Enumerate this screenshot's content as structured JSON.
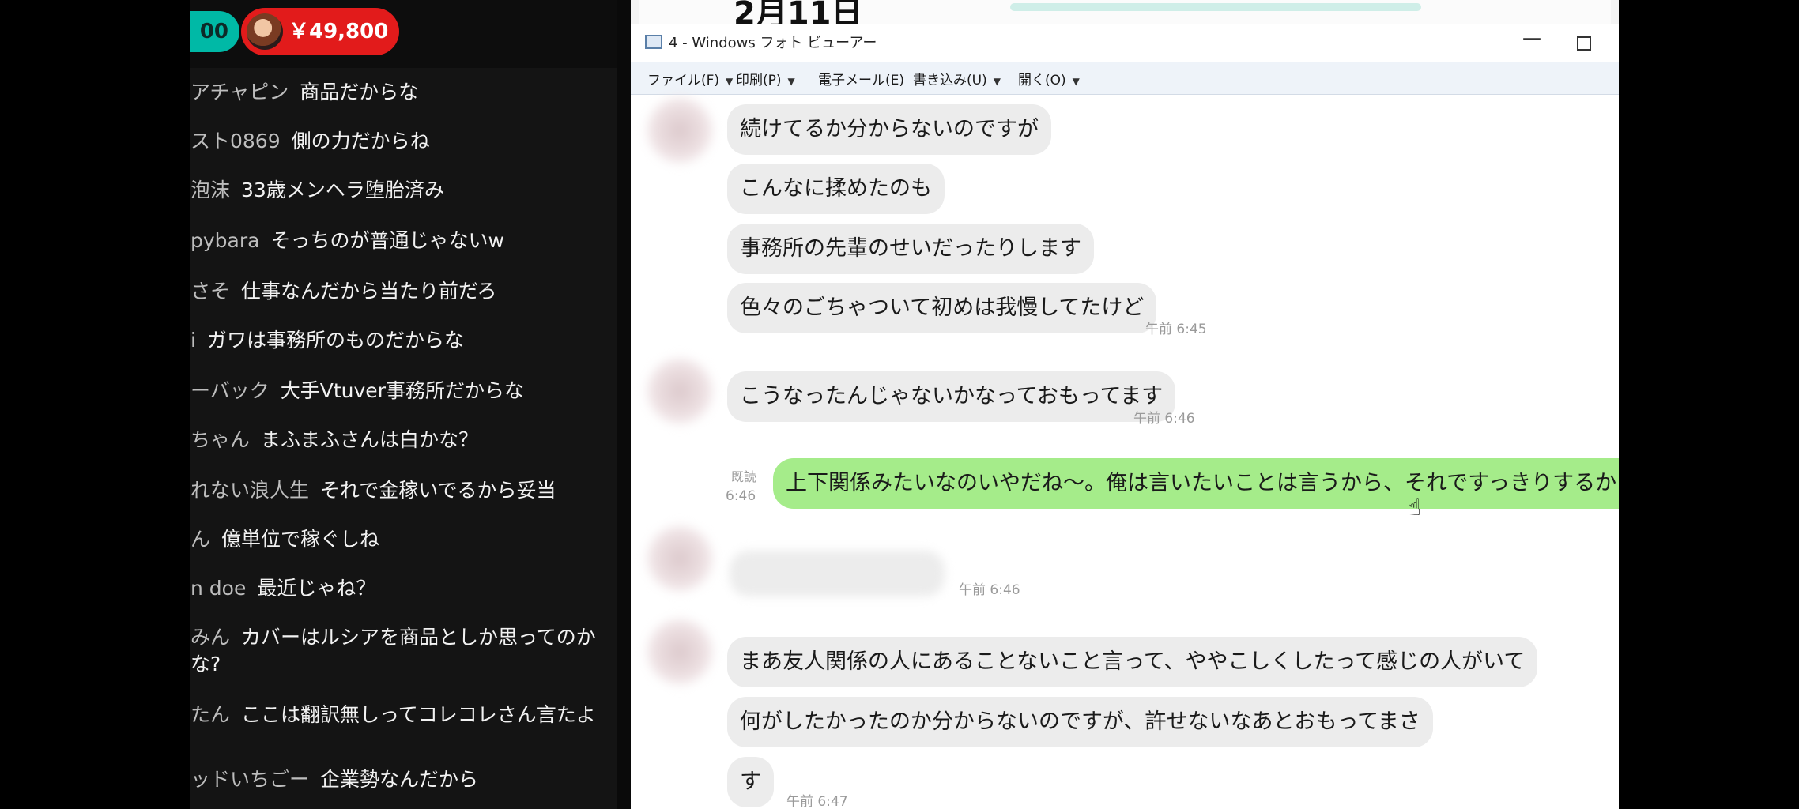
{
  "chat_panel": {
    "top_badge_number": "00",
    "superchat_amount": "￥49,800",
    "messages": [
      {
        "author": "アチャピン",
        "text": "商品だからな"
      },
      {
        "author": "スト0869",
        "text": "側の力だからね"
      },
      {
        "author": "泡沫",
        "text": "33歳メンヘラ堕胎済み"
      },
      {
        "author": "pybara",
        "text": "そっちのが普通じゃないw"
      },
      {
        "author": "さそ",
        "text": "仕事なんだから当たり前だろ"
      },
      {
        "author": "i",
        "text": "ガワは事務所のものだからな"
      },
      {
        "author": "ーバック",
        "text": "大手Vtuver事務所だからな"
      },
      {
        "author": "ちゃん",
        "text": "まふまふさんは白かな？"
      },
      {
        "author": "れない浪人生",
        "text": "それで金稼いでるから妥当"
      },
      {
        "author": "ん",
        "text": "億単位で稼ぐしね"
      },
      {
        "author": "n doe",
        "text": "最近じゃね？"
      },
      {
        "author": "みん",
        "text": "カバーはルシアを商品としか思ってのかな?"
      },
      {
        "author": "たん",
        "text": "ここは翻訳無しってコレコレさん言たよ"
      },
      {
        "author": "ッドいちごー",
        "text": "企業勢なんだから"
      }
    ]
  },
  "viewer": {
    "date_header": "2月11日",
    "window_title": "4 - Windows フォト ビューアー",
    "menu": [
      {
        "label": "ファイル(F)",
        "has_caret": true
      },
      {
        "label": "印刷(P)",
        "has_caret": true
      },
      {
        "label": "電子メール(E)",
        "has_caret": false
      },
      {
        "label": "書き込み(U)",
        "has_caret": true
      },
      {
        "label": "開く(O)",
        "has_caret": true
      }
    ],
    "messages": {
      "m1": "続けてるか分からないのですが",
      "m2": "こんなに揉めたのも",
      "m3": "事務所の先輩のせいだったりします",
      "m4": "色々のごちゃついて初めは我慢してたけど",
      "t4": "午前 6:45",
      "m5": "こうなったんじゃないかなっておもってます",
      "t5": "午前 6:46",
      "read_label": "既読",
      "t6": "6:46",
      "m6": "上下関係みたいなのいやだね〜。俺は言いたいことは言うから、それですっきりするからな～",
      "t7": "午前 6:46",
      "m8": "まあ友人関係の人にあることないこと言って、ややこしくしたって感じの人がいて",
      "m9": "何がしたかったのか分からないのですが、許せないなあとおもってまさ",
      "m10": "す",
      "t10": "午前 6:47"
    }
  }
}
